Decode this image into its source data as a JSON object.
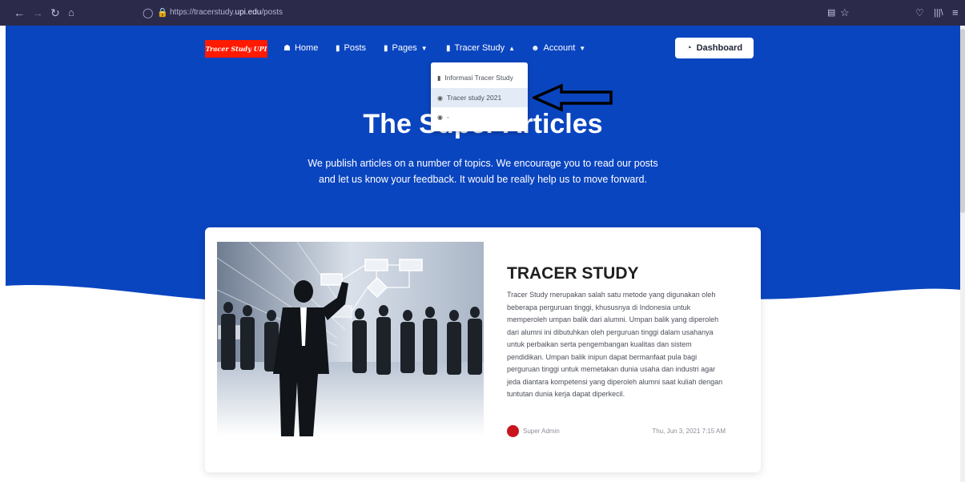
{
  "browser": {
    "url_prefix": "https://tracerstudy.",
    "url_domain": "upi.edu",
    "url_path": "/posts"
  },
  "nav": {
    "logo_text": "Tracer Study UPI",
    "items": [
      {
        "label": "Home",
        "icon": "home-icon"
      },
      {
        "label": "Posts",
        "icon": "file-icon"
      },
      {
        "label": "Pages",
        "icon": "file-icon",
        "dropdown": true
      },
      {
        "label": "Tracer Study",
        "icon": "file-icon",
        "dropdown": true,
        "open": true
      },
      {
        "label": "Account",
        "icon": "user-icon",
        "dropdown": true
      }
    ],
    "dashboard_label": "Dashboard"
  },
  "dropdown": {
    "items": [
      {
        "label": "Informasi Tracer Study",
        "icon": "file-icon"
      },
      {
        "label": "Tracer study 2021",
        "icon": "comments-icon",
        "active": true
      },
      {
        "label": "-",
        "icon": "comments-icon"
      }
    ]
  },
  "hero": {
    "title": "The Super Articles",
    "subtitle_line1": "We publish articles on a number of topics. We encourage you to read our posts",
    "subtitle_line2": "and let us know your feedback. It would be really help us to move forward."
  },
  "post": {
    "title": "TRACER STUDY",
    "body": "Tracer Study merupakan salah satu metode yang digunakan oleh beberapa perguruan tinggi, khususnya di Indonesia untuk memperoleh umpan balik dari alumni. Umpan balik yang diperoleh dari alumni ini dibutuhkan oleh perguruan tinggi dalam usahanya untuk perbaikan serta pengembangan kualitas dan sistem pendidikan. Umpan balik inipun dapat bermanfaat pula bagi perguruan tinggi untuk memetakan dunia usaha dan industri agar jeda diantara kompetensi yang diperoleh alumni saat kuliah dengan tuntutan dunia kerja dapat diperkecil.",
    "author": "Super Admin",
    "date": "Thu, Jun 3, 2021 7:15 AM"
  },
  "colors": {
    "hero_blue": "#0a45c0",
    "logo_red": "#ff1a00",
    "browser_bar": "#2b2a4a",
    "avatar_red": "#c8141e"
  }
}
